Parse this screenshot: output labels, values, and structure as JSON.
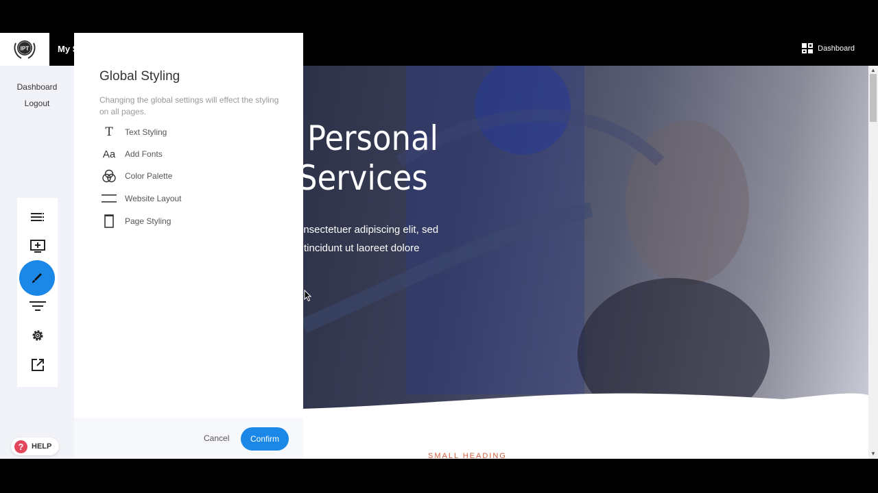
{
  "topbar": {
    "site_name": "My S",
    "dashboard_label": "Dashboard",
    "logo_text": "IPT"
  },
  "left_nav": {
    "dashboard": "Dashboard",
    "logout": "Logout"
  },
  "toolbar": {
    "icons": [
      "list-icon",
      "add-section-icon",
      "brush-icon",
      "filter-icon",
      "settings-icon",
      "external-link-icon"
    ],
    "active": "brush-icon"
  },
  "help": {
    "label": "HELP",
    "icon": "?"
  },
  "panel": {
    "title": "Global Styling",
    "description": "Changing the global settings will effect the styling on all pages.",
    "items": [
      {
        "label": "Text Styling",
        "icon": "T"
      },
      {
        "label": "Add Fonts",
        "icon": "Aa"
      },
      {
        "label": "Color Palette",
        "icon": "color-palette-icon"
      },
      {
        "label": "Website Layout",
        "icon": "layout-icon"
      },
      {
        "label": "Page Styling",
        "icon": "page-icon"
      }
    ],
    "cancel": "Cancel",
    "confirm": "Confirm"
  },
  "hero": {
    "title_line1": "Personal",
    "title_line2": "Services",
    "text_line1": "onsectetuer adipiscing elit, sed",
    "text_line2": "tincidunt ut laoreet dolore"
  },
  "section": {
    "small_heading": "SMALL HEADING"
  },
  "colors": {
    "accent": "#1b87e6",
    "help": "#e3455b",
    "small_heading": "#d35b3b"
  }
}
